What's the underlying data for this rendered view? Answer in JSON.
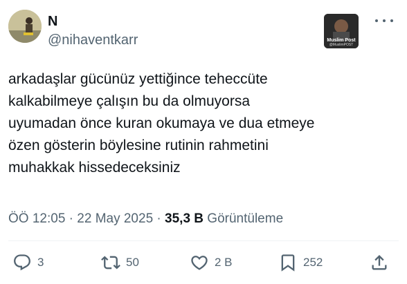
{
  "author": {
    "display_name": "N",
    "handle": "@nihaventkarr"
  },
  "badge": {
    "label": "Muslim Post",
    "sublabel": "@MuslimPOST"
  },
  "tweet": {
    "lines": [
      "arkadaşlar gücünüz yettiğince teheccüte",
      "kalkabilmeye çalışın bu da olmuyorsa",
      "uyumadan önce kuran okumaya ve dua etmeye",
      "özen gösterin böylesine rutinin rahmetini",
      "muhakkak hissedeceksiniz"
    ]
  },
  "meta": {
    "time": "ÖÖ 12:05",
    "separator": "·",
    "date": "22 May 2025",
    "views_count": "35,3 B",
    "views_label": "Görüntüleme"
  },
  "actions": {
    "replies": "3",
    "reposts": "50",
    "likes": "2 B",
    "bookmarks": "252"
  },
  "colors": {
    "text": "#0f1419",
    "secondary": "#536471",
    "divider": "#eff3f4"
  },
  "icons": [
    "more-icon",
    "reply-icon",
    "repost-icon",
    "like-icon",
    "bookmark-icon",
    "share-icon"
  ]
}
